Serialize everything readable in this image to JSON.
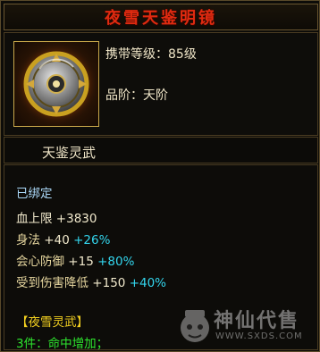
{
  "title": "夜雪天鉴明镜",
  "item": {
    "carry_level": "携带等级：85级",
    "grade": "品阶：天阶",
    "icon": "bronze-mirror-icon"
  },
  "section_title": "天鉴灵武",
  "bound": "已绑定",
  "stats": [
    {
      "name": "血上限",
      "value": "+3830",
      "pct": ""
    },
    {
      "name": "身法",
      "value": "+40",
      "pct": "+26%"
    },
    {
      "name": "会心防御",
      "value": "+15",
      "pct": "+80%"
    },
    {
      "name": "受到伤害降低",
      "value": "+150",
      "pct": "+40%"
    }
  ],
  "set": {
    "name": "【夜雪灵武】",
    "bonus": "3件：命中增加；"
  },
  "watermark": {
    "text": "神仙代售",
    "url": "WWW.SXDS.COM"
  },
  "colors": {
    "title": "#e02a10",
    "border": "#6a5630",
    "percent": "#33d6ee",
    "set_name": "#f2d020",
    "set_bonus": "#2ee62e"
  }
}
